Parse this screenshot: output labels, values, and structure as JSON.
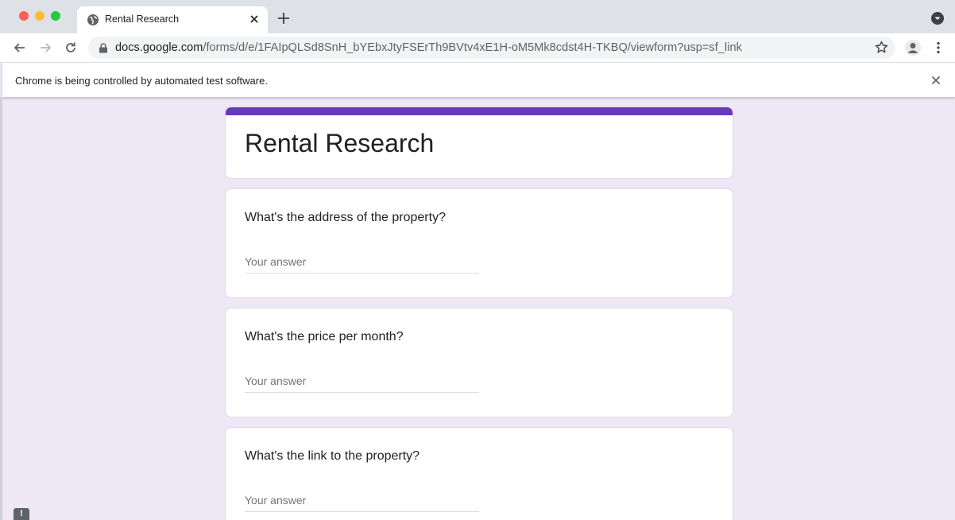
{
  "browser": {
    "tab_title": "Rental Research",
    "url_host": "docs.google.com",
    "url_path": "/forms/d/e/1FAIpQLSd8SnH_bYEbxJtyFSErTh9BVtv4xE1H-oM5Mk8cdst4H-TKBQ/viewform?usp=sf_link",
    "infobar_text": "Chrome is being controlled by automated test software."
  },
  "form": {
    "title": "Rental Research",
    "accent_color": "#673ab7",
    "background_color": "#ede7f6",
    "questions": [
      {
        "text": "What's the address of the property?",
        "placeholder": "Your answer"
      },
      {
        "text": "What's the price per month?",
        "placeholder": "Your answer"
      },
      {
        "text": "What's the link to the property?",
        "placeholder": "Your answer"
      }
    ]
  },
  "report_badge": "!"
}
